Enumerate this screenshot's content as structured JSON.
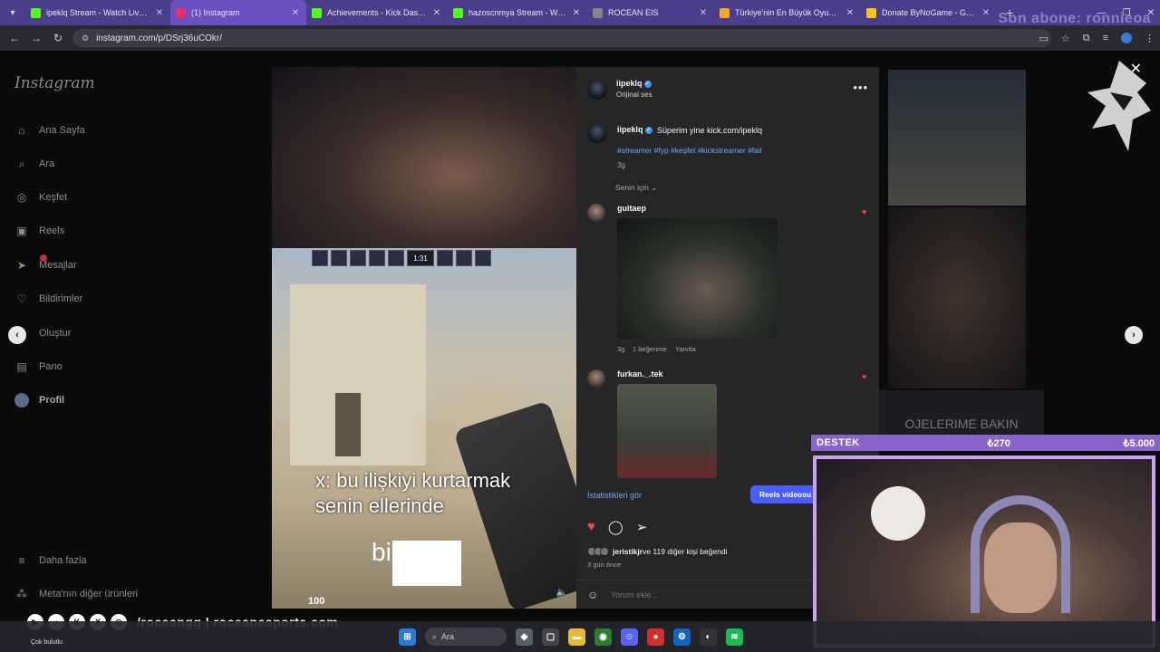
{
  "browser": {
    "tabs": [
      {
        "title": "ipeklq Stream - Watch Live on K",
        "favicon": "kick-icon",
        "color": "#53fc18",
        "active": false
      },
      {
        "title": "(1) Instagram",
        "favicon": "instagram-icon",
        "color": "#e1306c",
        "active": true
      },
      {
        "title": "Achievements - Kick Dashboard",
        "favicon": "kick-icon",
        "color": "#53fc18",
        "active": false
      },
      {
        "title": "hazoscnmya Stream - Watch Li",
        "favicon": "kick-icon",
        "color": "#53fc18",
        "active": false
      },
      {
        "title": "ROCEAN EIS",
        "favicon": "globe-icon",
        "color": "#888888",
        "active": false
      },
      {
        "title": "Türkiye'nin En Büyük Oyuncu D",
        "favicon": "spotify-icon",
        "color": "#f5a623",
        "active": false
      },
      {
        "title": "Donate ByNoGame - Gelen/Gi",
        "favicon": "bynogame-icon",
        "color": "#f5c518",
        "active": false
      }
    ],
    "url": "instagram.com/p/DSrj36uCOkr/",
    "overlay_text": "Son abone: ronnieoa"
  },
  "sidebar": {
    "logo": "Instagram",
    "items": [
      {
        "label": "Ana Sayfa",
        "icon": "home-icon",
        "glyph": "⌂"
      },
      {
        "label": "Ara",
        "icon": "search-icon",
        "glyph": "⌕"
      },
      {
        "label": "Keşfet",
        "icon": "compass-icon",
        "glyph": "◎"
      },
      {
        "label": "Reels",
        "icon": "reels-icon",
        "glyph": "▣"
      },
      {
        "label": "Mesajlar",
        "icon": "messenger-icon",
        "glyph": "➤"
      },
      {
        "label": "Bildirimler",
        "icon": "heart-icon",
        "glyph": "♡"
      },
      {
        "label": "Oluştur",
        "icon": "plus-icon",
        "glyph": "⊕"
      },
      {
        "label": "Pano",
        "icon": "dashboard-icon",
        "glyph": "▤"
      },
      {
        "label": "Profil",
        "icon": "avatar",
        "glyph": ""
      }
    ],
    "more": "Daha fazla",
    "meta": "Meta'nın diğer ürünleri"
  },
  "reel": {
    "caption_line1": "x: bu ilişkiyi kurtarmak",
    "caption_line2": "senin ellerinde",
    "caption_line3": "bi      ller",
    "hud_clock": "1:31",
    "ammo": "100",
    "side_caption": "OJELERIME BAKIN"
  },
  "post": {
    "author": "iipeklq",
    "audio": "Orijinal ses",
    "caption_text": "Süperim yine kick.com/ipeklq",
    "hashtags": "#streamer #fyp #keşfet #kickstreamer #fail",
    "caption_time": "3g",
    "sort_label": "Senin için",
    "comments": [
      {
        "user": "guitaep",
        "time": "3g",
        "likes": "1 beğenme",
        "reply": "Yanıtla"
      },
      {
        "user": "furkan._.tek"
      }
    ],
    "stats_link": "İstatistikleri gör",
    "cta": "Reels videosu",
    "likes_text_user": "jeristikjr",
    "likes_text_rest": " ve 119 diğer kişi beğendi",
    "posted": "3 gün önce",
    "comment_placeholder": "Yorum ekle..."
  },
  "stream": {
    "destek_label": "DESTEK",
    "destek_current": "₺270",
    "destek_goal": "₺5.000",
    "handle": "/roceangg | roceanesports.com"
  },
  "taskbar": {
    "weather": "Çok bulutlu",
    "search": "Ara"
  }
}
